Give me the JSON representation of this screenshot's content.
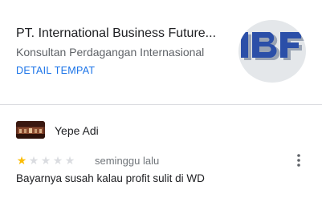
{
  "place": {
    "name": "PT. International Business Future...",
    "category": "Konsultan Perdagangan Internasional",
    "details_link": "DETAIL TEMPAT",
    "logo_text": "IBF",
    "logo_color": "#2b4fa8"
  },
  "review": {
    "author": "Yepe Adi",
    "rating": 1,
    "max_rating": 5,
    "time": "seminggu lalu",
    "text": "Bayarnya susah kalau profit sulit di WD",
    "star_color": "#fbbc04",
    "menu_icon": "more-vert-icon"
  }
}
